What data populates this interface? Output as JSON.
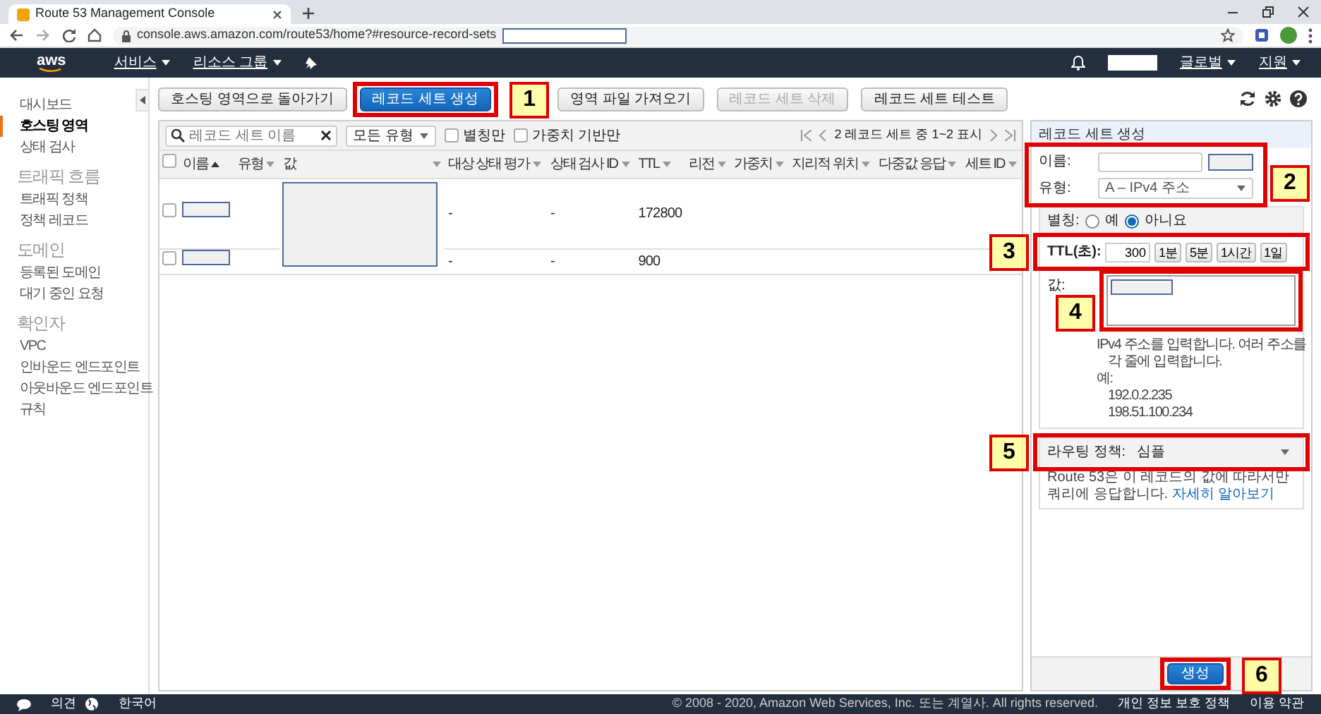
{
  "browser": {
    "tab_title": "Route 53 Management Console",
    "url": "console.aws.amazon.com/route53/home?#resource-record-sets"
  },
  "topnav": {
    "logo": "aws",
    "menus": [
      {
        "label": "서비스"
      },
      {
        "label": "리소스 그룹"
      }
    ],
    "right_menus": [
      {
        "label": "글로벌"
      },
      {
        "label": "지원"
      }
    ]
  },
  "sidebar": {
    "items": [
      {
        "kind": "link",
        "label": "대시보드",
        "selected": false
      },
      {
        "kind": "link",
        "label": "호스팅 영역",
        "selected": true
      },
      {
        "kind": "link",
        "label": "상태 검사",
        "selected": false
      },
      {
        "kind": "heading",
        "label": "트래픽 흐름"
      },
      {
        "kind": "link",
        "label": "트래픽 정책",
        "selected": false
      },
      {
        "kind": "link",
        "label": "정책 레코드",
        "selected": false
      },
      {
        "kind": "heading",
        "label": "도메인"
      },
      {
        "kind": "link",
        "label": "등록된 도메인",
        "selected": false
      },
      {
        "kind": "link",
        "label": "대기 중인 요청",
        "selected": false
      },
      {
        "kind": "heading",
        "label": "확인자"
      },
      {
        "kind": "link",
        "label": "VPC",
        "selected": false
      },
      {
        "kind": "link",
        "label": "인바운드 엔드포인트",
        "selected": false
      },
      {
        "kind": "link",
        "label": "아웃바운드 엔드포인트",
        "selected": false
      },
      {
        "kind": "link",
        "label": "규칙",
        "selected": false
      }
    ]
  },
  "toolbar": {
    "buttons": [
      {
        "label": "호스팅 영역으로 돌아가기",
        "kind": "default",
        "disabled": false
      },
      {
        "label": "레코드 세트 생성",
        "kind": "primary",
        "disabled": false
      },
      {
        "label": "영역 파일 가져오기",
        "kind": "default",
        "disabled": false
      },
      {
        "label": "레코드 세트 삭제",
        "kind": "default",
        "disabled": true
      },
      {
        "label": "레코드 세트 테스트",
        "kind": "default",
        "disabled": false
      }
    ]
  },
  "filter": {
    "search_placeholder": "레코드 세트 이름",
    "type_select": "모든 유형",
    "checkboxes": [
      {
        "label": "별칭만",
        "checked": false
      },
      {
        "label": "가중치 기반만",
        "checked": false
      }
    ],
    "pager": "2 레코드 세트 중 1~2 표시"
  },
  "table": {
    "all_selected": false,
    "columns": [
      "이름",
      "유형",
      "값",
      "대상 상태 평가",
      "상태 검사 ID",
      "TTL",
      "리전",
      "가중치",
      "지리적 위치",
      "다중값 응답",
      "세트 ID"
    ],
    "rows": [
      {
        "selected": false,
        "health_eval": "-",
        "health_check_id": "-",
        "ttl": "172800"
      },
      {
        "selected": false,
        "health_eval": "-",
        "health_check_id": "-",
        "ttl": "900"
      }
    ]
  },
  "form": {
    "title": "레코드 세트 생성",
    "name_label": "이름:",
    "type_label": "유형:",
    "type_value": "A – IPv4 주소",
    "alias_label": "별칭:",
    "alias_options": [
      {
        "label": "예",
        "selected": false
      },
      {
        "label": "아니요",
        "selected": true
      }
    ],
    "ttl_label": "TTL(초):",
    "ttl_value": "300",
    "ttl_buttons": [
      "1분",
      "5분",
      "1시간",
      "1일"
    ],
    "value_label": "값:",
    "value_help": [
      "IPv4 주소를 입력합니다. 여러 주소를",
      "각 줄에 입력합니다.",
      "예:",
      "192.0.2.235",
      "198.51.100.234"
    ],
    "routing_label": "라우팅 정책:",
    "routing_value": "심플",
    "routing_help": "Route 53은 이 레코드의 값에 따라서만 쿼리에 응답합니다.",
    "learn_more": "자세히 알아보기",
    "submit": "생성"
  },
  "footer": {
    "feedback": "의견",
    "language": "한국어",
    "copyright": "© 2008 - 2020, Amazon Web Services, Inc. 또는 계열사. All rights reserved.",
    "links": [
      "개인 정보 보호 정책",
      "이용 약관"
    ]
  },
  "annotations": [
    {
      "number": "1"
    },
    {
      "number": "2"
    },
    {
      "number": "3"
    },
    {
      "number": "4"
    },
    {
      "number": "5"
    },
    {
      "number": "6"
    }
  ]
}
